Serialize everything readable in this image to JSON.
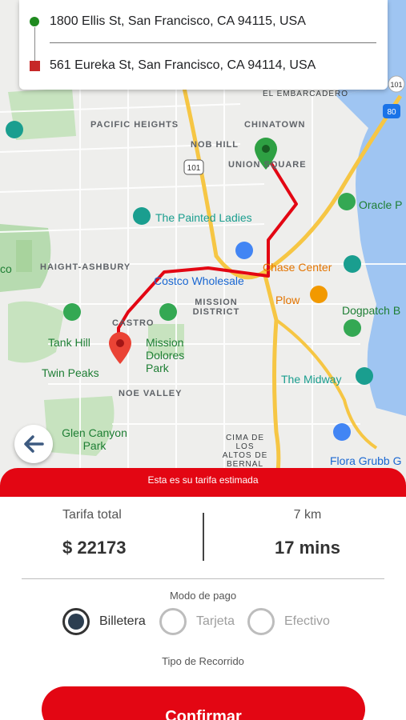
{
  "addresses": {
    "origin": "1800 Ellis St, San Francisco, CA 94115, USA",
    "destination": "561 Eureka St, San Francisco, CA 94114, USA"
  },
  "map": {
    "districts": [
      "PACIFIC HEIGHTS",
      "NOB HILL",
      "UNION SQUARE",
      "CHINATOWN",
      "HAIGHT-ASHBURY",
      "MISSION DISTRICT",
      "CASTRO",
      "NOE VALLEY",
      "CIMA DE LOS ALTOS DE BERNAL"
    ],
    "streets": [
      "EL EMBARCADERO"
    ],
    "pois": [
      "The Painted Ladies",
      "Costco Wholesale",
      "Chase Center",
      "Plow",
      "Dogpatch B",
      "Tank Hill",
      "Mission Dolores Park",
      "Twin Peaks",
      "The Midway",
      "Glen Canyon Park",
      "Flora Grubb G",
      "Oracle P",
      "co"
    ],
    "highways": [
      "101",
      "101",
      "80"
    ]
  },
  "sheet": {
    "header": "Esta es su tarifa estimada",
    "fare_label": "Tarifa total",
    "fare_value": "$ 22173",
    "distance": "7 km",
    "duration": "17 mins",
    "payment_label": "Modo de pago",
    "payment_options": [
      "Billetera",
      "Tarjeta",
      "Efectivo"
    ],
    "selected_payment": "Billetera",
    "trip_type_label": "Tipo de Recorrido",
    "confirm": "Confirmar"
  },
  "colors": {
    "accent": "#e30613",
    "origin": "#1f8a1f",
    "destination": "#c62828",
    "route": "#e30613"
  }
}
